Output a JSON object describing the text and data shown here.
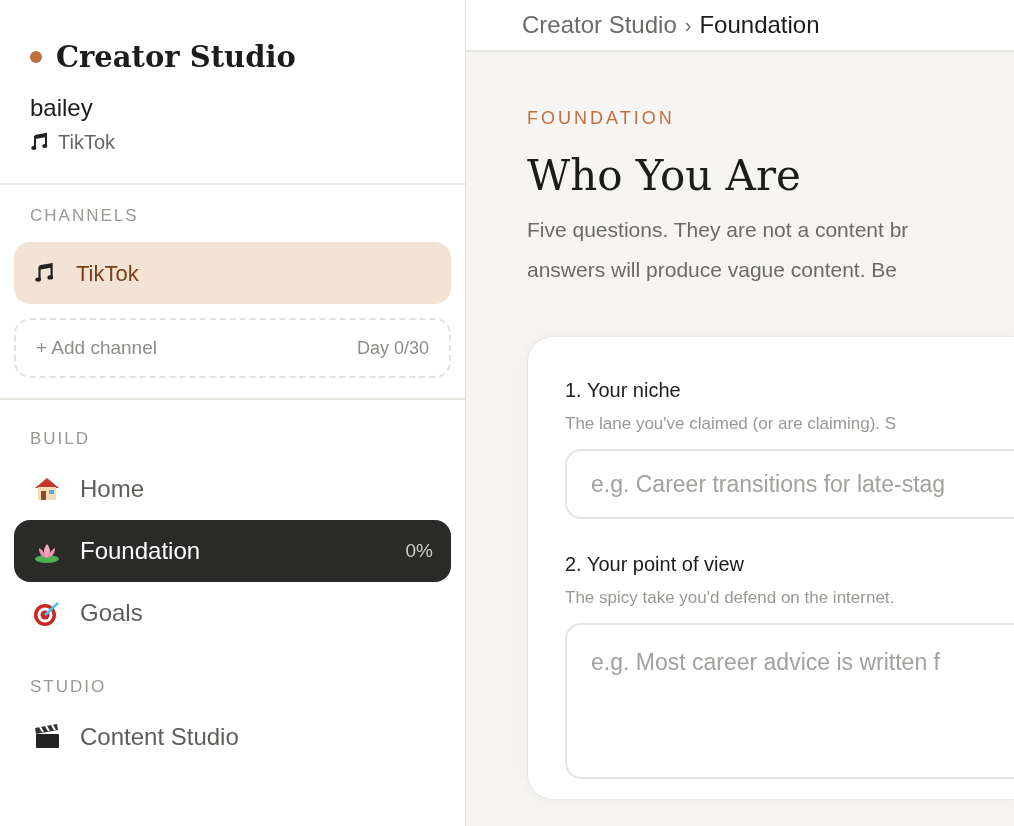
{
  "sidebar": {
    "brand": "Creator Studio",
    "user": {
      "name": "bailey",
      "platform": "TikTok"
    },
    "channels": {
      "heading": "CHANNELS",
      "items": [
        {
          "label": "TikTok",
          "selected": true
        }
      ],
      "add_button": "+ Add channel",
      "progress": "Day 0/30"
    },
    "nav_sections": [
      {
        "heading": "BUILD",
        "items": [
          {
            "label": "Home",
            "kind": "house",
            "selected": false
          },
          {
            "label": "Foundation",
            "kind": "lotus",
            "selected": true,
            "badge": "0%"
          },
          {
            "label": "Goals",
            "kind": "target",
            "selected": false
          }
        ]
      },
      {
        "heading": "STUDIO",
        "items": [
          {
            "label": "Content Studio",
            "kind": "clapper",
            "selected": false
          }
        ]
      }
    ]
  },
  "main": {
    "breadcrumb": {
      "parent": "Creator Studio",
      "separator": "›",
      "current": "Foundation"
    },
    "eyebrow": "FOUNDATION",
    "title": "Who You Are",
    "intro": [
      "Five questions. They are not a content br",
      "answers will produce vague content. Be"
    ],
    "questions": [
      {
        "label": "1. Your niche",
        "hint": "The lane you've claimed (or are claiming). S",
        "placeholder": "e.g. Career transitions for late-stag",
        "kind": "input"
      },
      {
        "label": "2. Your point of view",
        "hint": "The spicy take you'd defend on the internet.",
        "placeholder": "e.g. Most career advice is written f",
        "kind": "textarea"
      }
    ]
  }
}
